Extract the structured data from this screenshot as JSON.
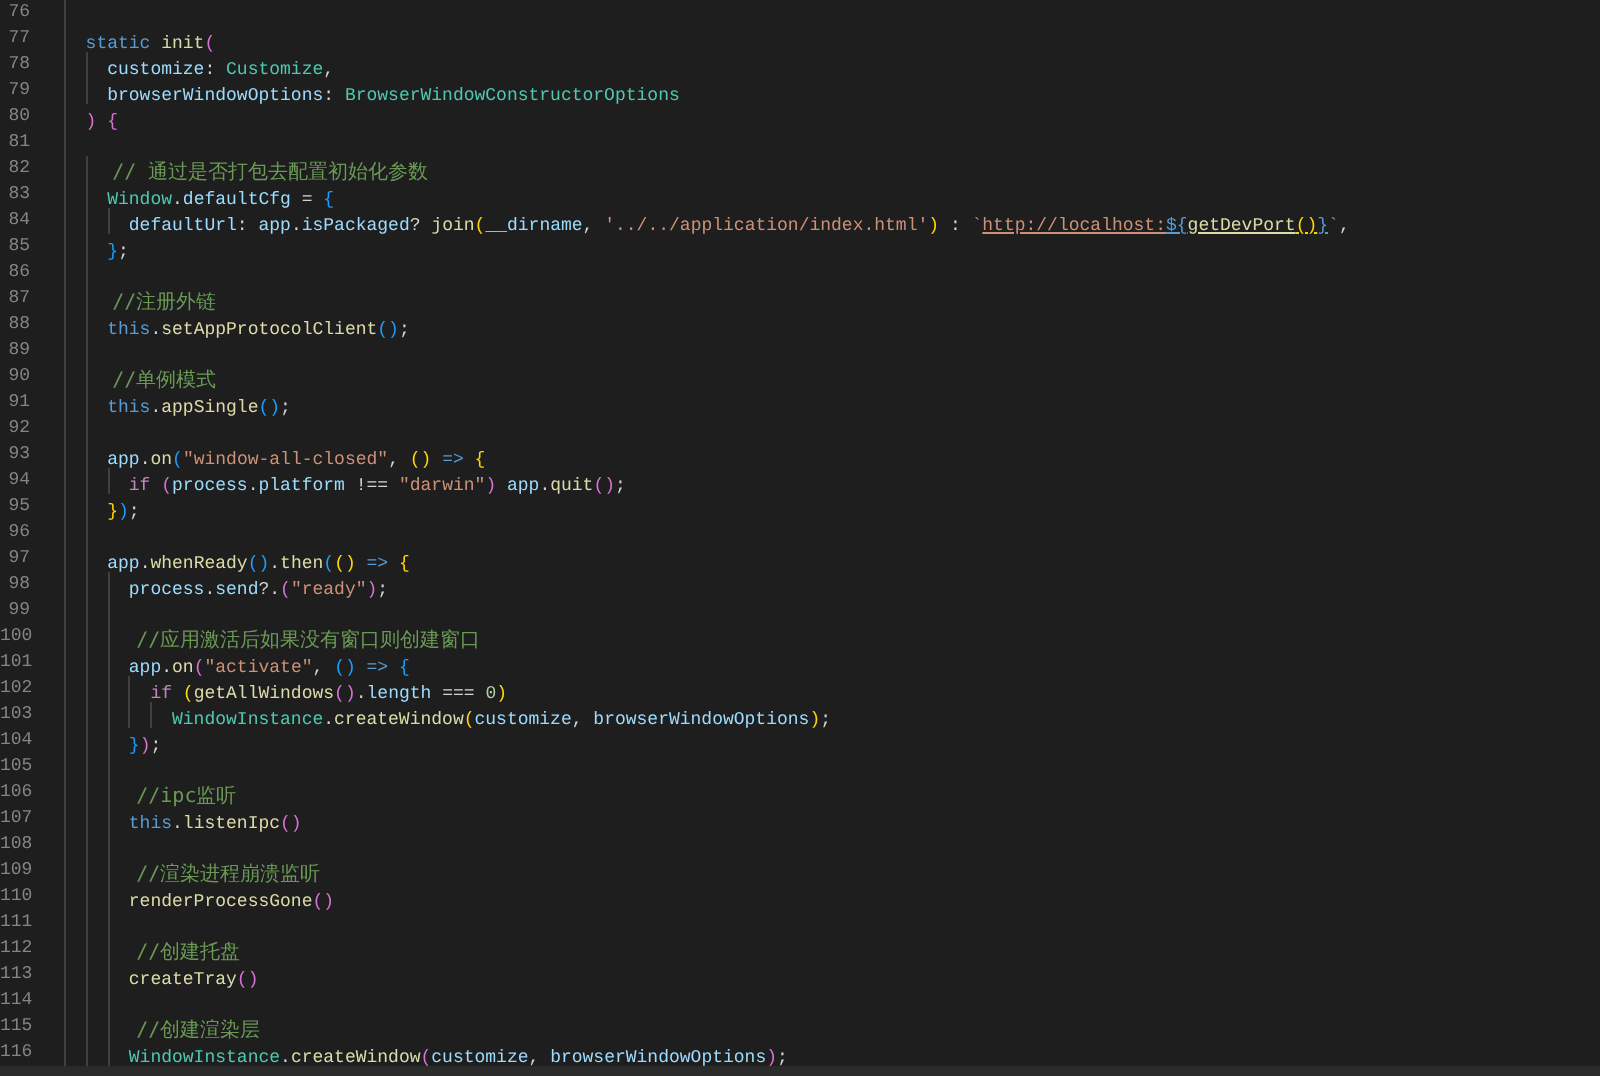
{
  "editor": {
    "lines": [
      {
        "number": "76"
      },
      {
        "number": "77",
        "tokens": [
          {
            "kind": "kw",
            "text": "  static "
          },
          {
            "kind": "fn",
            "text": "init"
          },
          {
            "kind": "b2",
            "text": "("
          }
        ]
      },
      {
        "number": "78",
        "tokens": [
          {
            "kind": "var",
            "text": "    customize"
          },
          {
            "kind": "p",
            "text": ": "
          },
          {
            "kind": "type",
            "text": "Customize"
          },
          {
            "kind": "p",
            "text": ","
          }
        ]
      },
      {
        "number": "79",
        "tokens": [
          {
            "kind": "var",
            "text": "    browserWindowOptions"
          },
          {
            "kind": "p",
            "text": ": "
          },
          {
            "kind": "type",
            "text": "BrowserWindowConstructorOptions"
          }
        ]
      },
      {
        "number": "80",
        "tokens": [
          {
            "kind": "b2",
            "text": "  ) "
          },
          {
            "kind": "b2",
            "text": "{"
          }
        ]
      },
      {
        "number": "81"
      },
      {
        "number": "82",
        "tokens": [
          {
            "kind": "cmt",
            "text": "    // 通过是否打包去配置初始化参数"
          }
        ]
      },
      {
        "number": "83",
        "tokens": [
          {
            "kind": "type",
            "text": "    Window"
          },
          {
            "kind": "p",
            "text": "."
          },
          {
            "kind": "var",
            "text": "defaultCfg"
          },
          {
            "kind": "p",
            "text": " = "
          },
          {
            "kind": "b3",
            "text": "{"
          }
        ]
      },
      {
        "number": "84",
        "tokens": [
          {
            "kind": "var",
            "text": "      defaultUrl"
          },
          {
            "kind": "p",
            "text": ": "
          },
          {
            "kind": "var",
            "text": "app"
          },
          {
            "kind": "p",
            "text": "."
          },
          {
            "kind": "var",
            "text": "isPackaged"
          },
          {
            "kind": "p",
            "text": "? "
          },
          {
            "kind": "fn",
            "text": "join"
          },
          {
            "kind": "b1",
            "text": "("
          },
          {
            "kind": "var",
            "text": "__dirname"
          },
          {
            "kind": "p",
            "text": ", "
          },
          {
            "kind": "str",
            "text": "'../../application/index.html'"
          },
          {
            "kind": "b1",
            "text": ")"
          },
          {
            "kind": "p",
            "text": " : "
          },
          {
            "kind": "str",
            "text": "`"
          },
          {
            "kind": "str",
            "text": "http://localhost:",
            "underline": true
          },
          {
            "kind": "kw",
            "text": "${",
            "underline": true
          },
          {
            "kind": "fn",
            "text": "getDevPort",
            "underline": true
          },
          {
            "kind": "b1",
            "text": "()",
            "underline": true
          },
          {
            "kind": "kw",
            "text": "}",
            "underline": true
          },
          {
            "kind": "str",
            "text": "`"
          },
          {
            "kind": "p",
            "text": ","
          }
        ]
      },
      {
        "number": "85",
        "tokens": [
          {
            "kind": "b3",
            "text": "    }"
          },
          {
            "kind": "p",
            "text": ";"
          }
        ]
      },
      {
        "number": "86"
      },
      {
        "number": "87",
        "tokens": [
          {
            "kind": "cmt",
            "text": "    //注册外链"
          }
        ]
      },
      {
        "number": "88",
        "tokens": [
          {
            "kind": "kw",
            "text": "    this"
          },
          {
            "kind": "p",
            "text": "."
          },
          {
            "kind": "fn",
            "text": "setAppProtocolClient"
          },
          {
            "kind": "b3",
            "text": "()"
          },
          {
            "kind": "p",
            "text": ";"
          }
        ]
      },
      {
        "number": "89"
      },
      {
        "number": "90",
        "tokens": [
          {
            "kind": "cmt",
            "text": "    //单例模式"
          }
        ]
      },
      {
        "number": "91",
        "tokens": [
          {
            "kind": "kw",
            "text": "    this"
          },
          {
            "kind": "p",
            "text": "."
          },
          {
            "kind": "fn",
            "text": "appSingle"
          },
          {
            "kind": "b3",
            "text": "()"
          },
          {
            "kind": "p",
            "text": ";"
          }
        ]
      },
      {
        "number": "92"
      },
      {
        "number": "93",
        "tokens": [
          {
            "kind": "var",
            "text": "    app"
          },
          {
            "kind": "p",
            "text": "."
          },
          {
            "kind": "fn",
            "text": "on"
          },
          {
            "kind": "b3",
            "text": "("
          },
          {
            "kind": "str",
            "text": "\"window-all-closed\""
          },
          {
            "kind": "p",
            "text": ", "
          },
          {
            "kind": "b1",
            "text": "() "
          },
          {
            "kind": "kw",
            "text": "=> "
          },
          {
            "kind": "b1",
            "text": "{"
          }
        ]
      },
      {
        "number": "94",
        "tokens": [
          {
            "kind": "ctrl",
            "text": "      if "
          },
          {
            "kind": "b2",
            "text": "("
          },
          {
            "kind": "var",
            "text": "process"
          },
          {
            "kind": "p",
            "text": "."
          },
          {
            "kind": "var",
            "text": "platform"
          },
          {
            "kind": "p",
            "text": " !== "
          },
          {
            "kind": "str",
            "text": "\"darwin\""
          },
          {
            "kind": "b2",
            "text": ") "
          },
          {
            "kind": "var",
            "text": "app"
          },
          {
            "kind": "p",
            "text": "."
          },
          {
            "kind": "fn",
            "text": "quit"
          },
          {
            "kind": "b2",
            "text": "()"
          },
          {
            "kind": "p",
            "text": ";"
          }
        ]
      },
      {
        "number": "95",
        "tokens": [
          {
            "kind": "b1",
            "text": "    }"
          },
          {
            "kind": "b3",
            "text": ")"
          },
          {
            "kind": "p",
            "text": ";"
          }
        ]
      },
      {
        "number": "96"
      },
      {
        "number": "97",
        "tokens": [
          {
            "kind": "var",
            "text": "    app"
          },
          {
            "kind": "p",
            "text": "."
          },
          {
            "kind": "fn",
            "text": "whenReady"
          },
          {
            "kind": "b3",
            "text": "()"
          },
          {
            "kind": "p",
            "text": "."
          },
          {
            "kind": "fn",
            "text": "then"
          },
          {
            "kind": "b3",
            "text": "("
          },
          {
            "kind": "b1",
            "text": "() "
          },
          {
            "kind": "kw",
            "text": "=> "
          },
          {
            "kind": "b1",
            "text": "{"
          }
        ]
      },
      {
        "number": "98",
        "tokens": [
          {
            "kind": "var",
            "text": "      process"
          },
          {
            "kind": "p",
            "text": "."
          },
          {
            "kind": "var",
            "text": "send"
          },
          {
            "kind": "p",
            "text": "?."
          },
          {
            "kind": "b2",
            "text": "("
          },
          {
            "kind": "str",
            "text": "\"ready\""
          },
          {
            "kind": "b2",
            "text": ")"
          },
          {
            "kind": "p",
            "text": ";"
          }
        ]
      },
      {
        "number": "99"
      },
      {
        "number": "100",
        "tokens": [
          {
            "kind": "cmt",
            "text": "      //应用激活后如果没有窗口则创建窗口"
          }
        ]
      },
      {
        "number": "101",
        "tokens": [
          {
            "kind": "var",
            "text": "      app"
          },
          {
            "kind": "p",
            "text": "."
          },
          {
            "kind": "fn",
            "text": "on"
          },
          {
            "kind": "b2",
            "text": "("
          },
          {
            "kind": "str",
            "text": "\"activate\""
          },
          {
            "kind": "p",
            "text": ", "
          },
          {
            "kind": "b3",
            "text": "() "
          },
          {
            "kind": "kw",
            "text": "=> "
          },
          {
            "kind": "b3",
            "text": "{"
          }
        ]
      },
      {
        "number": "102",
        "tokens": [
          {
            "kind": "ctrl",
            "text": "        if "
          },
          {
            "kind": "b1",
            "text": "("
          },
          {
            "kind": "fn",
            "text": "getAllWindows"
          },
          {
            "kind": "b2",
            "text": "()"
          },
          {
            "kind": "p",
            "text": "."
          },
          {
            "kind": "var",
            "text": "length"
          },
          {
            "kind": "p",
            "text": " === "
          },
          {
            "kind": "num",
            "text": "0"
          },
          {
            "kind": "b1",
            "text": ")"
          }
        ]
      },
      {
        "number": "103",
        "tokens": [
          {
            "kind": "type",
            "text": "          WindowInstance"
          },
          {
            "kind": "p",
            "text": "."
          },
          {
            "kind": "fn",
            "text": "createWindow"
          },
          {
            "kind": "b1",
            "text": "("
          },
          {
            "kind": "var",
            "text": "customize"
          },
          {
            "kind": "p",
            "text": ", "
          },
          {
            "kind": "var",
            "text": "browserWindowOptions"
          },
          {
            "kind": "b1",
            "text": ")"
          },
          {
            "kind": "p",
            "text": ";"
          }
        ]
      },
      {
        "number": "104",
        "tokens": [
          {
            "kind": "b3",
            "text": "      }"
          },
          {
            "kind": "b2",
            "text": ")"
          },
          {
            "kind": "p",
            "text": ";"
          }
        ]
      },
      {
        "number": "105"
      },
      {
        "number": "106",
        "tokens": [
          {
            "kind": "cmt",
            "text": "      //ipc监听"
          }
        ]
      },
      {
        "number": "107",
        "tokens": [
          {
            "kind": "kw",
            "text": "      this"
          },
          {
            "kind": "p",
            "text": "."
          },
          {
            "kind": "fn",
            "text": "listenIpc"
          },
          {
            "kind": "b2",
            "text": "()"
          }
        ]
      },
      {
        "number": "108"
      },
      {
        "number": "109",
        "tokens": [
          {
            "kind": "cmt",
            "text": "      //渲染进程崩溃监听"
          }
        ]
      },
      {
        "number": "110",
        "tokens": [
          {
            "kind": "fn",
            "text": "      renderProcessGone"
          },
          {
            "kind": "b2",
            "text": "()"
          }
        ]
      },
      {
        "number": "111"
      },
      {
        "number": "112",
        "tokens": [
          {
            "kind": "cmt",
            "text": "      //创建托盘"
          }
        ]
      },
      {
        "number": "113",
        "tokens": [
          {
            "kind": "fn",
            "text": "      createTray"
          },
          {
            "kind": "b2",
            "text": "()"
          }
        ]
      },
      {
        "number": "114"
      },
      {
        "number": "115",
        "tokens": [
          {
            "kind": "cmt",
            "text": "      //创建渲染层"
          }
        ]
      },
      {
        "number": "116",
        "tokens": [
          {
            "kind": "type",
            "text": "      WindowInstance"
          },
          {
            "kind": "p",
            "text": "."
          },
          {
            "kind": "fn",
            "text": "createWindow"
          },
          {
            "kind": "b2",
            "text": "("
          },
          {
            "kind": "var",
            "text": "customize"
          },
          {
            "kind": "p",
            "text": ", "
          },
          {
            "kind": "var",
            "text": "browserWindowOptions"
          },
          {
            "kind": "b2",
            "text": ")"
          },
          {
            "kind": "p",
            "text": ";"
          }
        ]
      }
    ]
  }
}
